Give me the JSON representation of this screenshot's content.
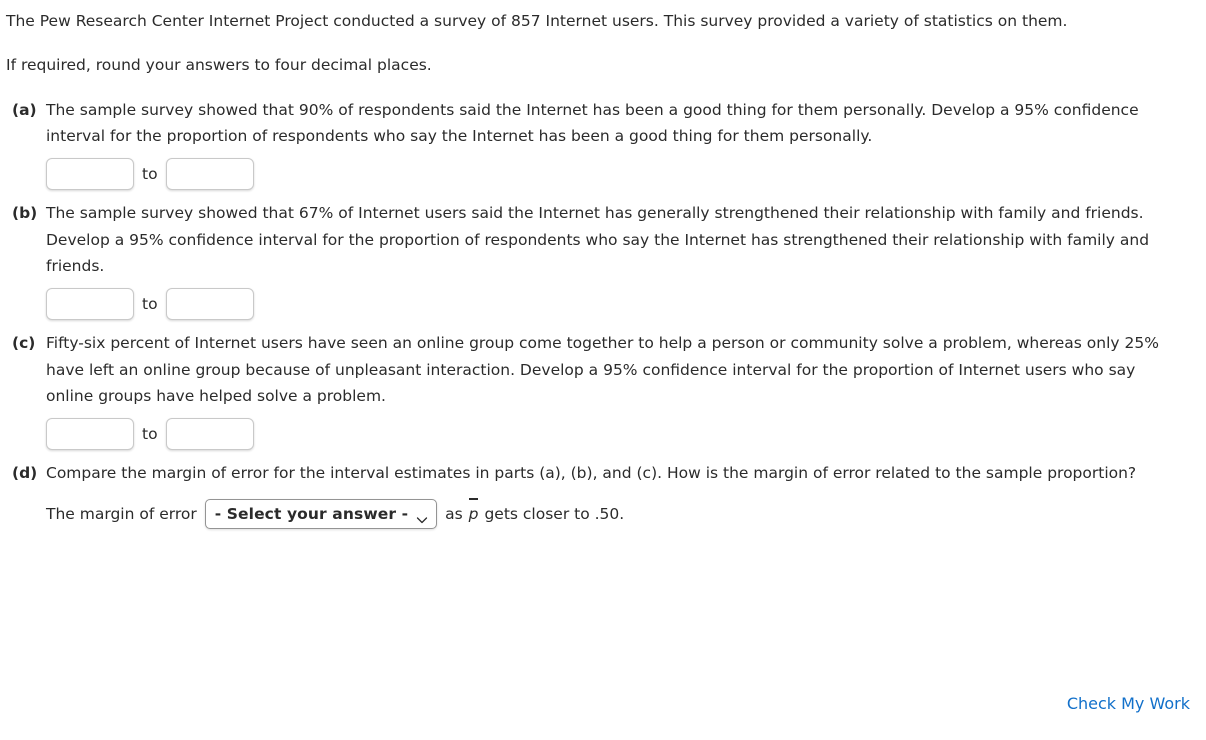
{
  "intro": {
    "paragraph1": "The Pew Research Center Internet Project conducted a survey of 857 Internet users. This survey provided a variety of statistics on them.",
    "paragraph2": "If required, round your answers to four decimal places."
  },
  "parts": [
    {
      "label": "(a)",
      "text": "The sample survey showed that 90% of respondents said the Internet has been a good thing for them personally. Develop a 95% confidence interval for the proportion of respondents who say the Internet has been a good thing for them personally.",
      "lower_value": "",
      "upper_value": "",
      "lower_placeholder": "",
      "upper_placeholder": "",
      "connector": "to"
    },
    {
      "label": "(b)",
      "text": "The sample survey showed that 67% of Internet users said the Internet has generally strengthened their relationship with family and friends. Develop a 95% confidence interval for the proportion of respondents who say the Internet has strengthened their relationship with family and friends.",
      "lower_value": "",
      "upper_value": "",
      "lower_placeholder": "",
      "upper_placeholder": "",
      "connector": "to"
    },
    {
      "label": "(c)",
      "text": "Fifty-six percent of Internet users have seen an online group come together to help a person or community solve a problem, whereas only 25% have left an online group because of unpleasant interaction. Develop a 95% confidence interval for the proportion of Internet users who say online groups have helped solve a problem.",
      "lower_value": "",
      "upper_value": "",
      "lower_placeholder": "",
      "upper_placeholder": "",
      "connector": "to"
    },
    {
      "label": "(d)",
      "text": "Compare the margin of error for the interval estimates in parts (a), (b), and (c). How is the margin of error related to the sample proportion?",
      "select_lead": "The margin of error",
      "select_value": "- Select your answer -",
      "select_trail_prefix": "as",
      "select_trail_symbol": "p",
      "select_trail_suffix": "gets closer to .50.",
      "select_icon": "chevron-down-icon"
    }
  ],
  "footer": {
    "check_work_label": "Check My Work",
    "link_color": "#1270ca"
  }
}
